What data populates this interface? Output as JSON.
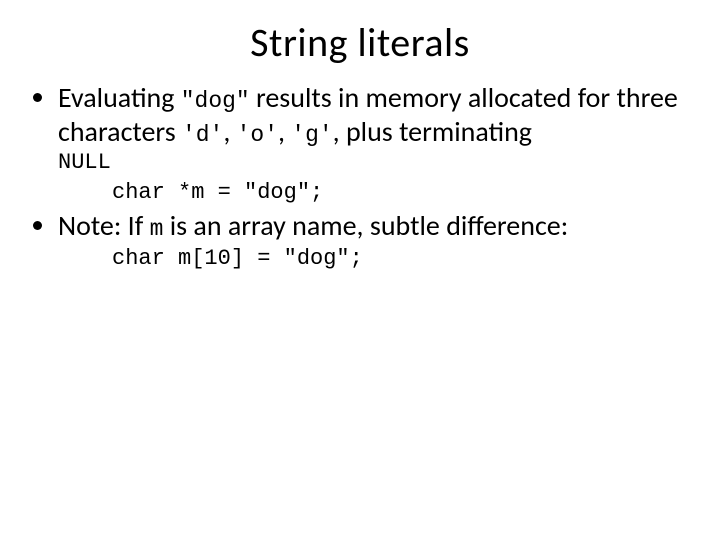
{
  "title": "String literals",
  "bullets": {
    "b1": {
      "pre": "Evaluating ",
      "code1": "\"dog\"",
      "mid1": " results in memory allocated for three characters ",
      "code2": "'d'",
      "sep1": ", ",
      "code3": "'o'",
      "sep2": ", ",
      "code4": "'g'",
      "mid2": ", plus terminating ",
      "nullword": "NULL",
      "codeline": "char *m = \"dog\";"
    },
    "b2": {
      "pre": "Note: If ",
      "code1": "m",
      "mid": " is an array name, subtle difference:",
      "codeline": "char m[10] = \"dog\";"
    }
  }
}
